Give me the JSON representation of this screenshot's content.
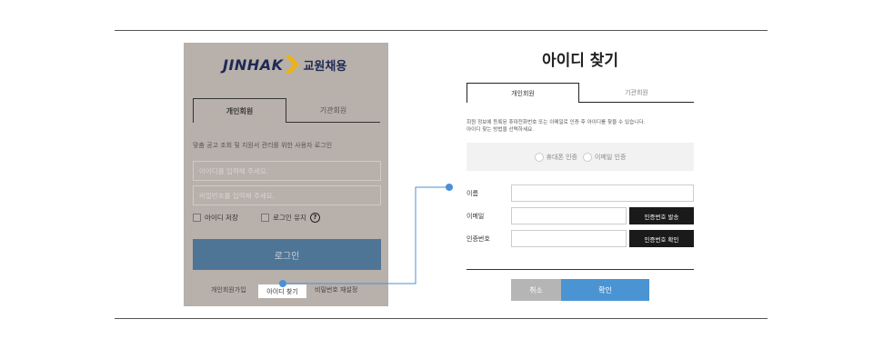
{
  "login": {
    "logo_main": "JINHAK",
    "logo_sub": "교원채용",
    "tabs": [
      {
        "label": "개인회원",
        "active": true
      },
      {
        "label": "기관회원",
        "active": false
      }
    ],
    "description": "맞춤 공고 조회 및 지원서 관리를 위한 사용자 로그인",
    "id_placeholder": "아이디를 입력해 주세요.",
    "pw_placeholder": "비밀번호를 입력해 주세요.",
    "save_id_label": "아이디 저장",
    "keep_login_label": "로그인 유지",
    "help_glyph": "?",
    "login_button": "로그인",
    "footer": {
      "join": "개인회원가입",
      "find_id": "아이디 찾기",
      "reset_pw": "비밀번호 재설정"
    }
  },
  "find_id": {
    "title": "아이디 찾기",
    "tabs": [
      {
        "label": "개인회원",
        "active": true
      },
      {
        "label": "기관회원",
        "active": false
      }
    ],
    "description_line1": "회원 정보에 등록된 휴대전화번호 또는 이메일로 인증 후 아이디를 찾을 수 있습니다.",
    "description_line2": "아이디 찾는 방법을 선택하세요.",
    "methods": [
      {
        "label": "휴대폰 인증"
      },
      {
        "label": "이메일 인증"
      }
    ],
    "fields": {
      "name_label": "이름",
      "email_label": "이메일",
      "code_label": "인증번호"
    },
    "send_code_button": "인증번호 발송",
    "verify_code_button": "인증번호 확인",
    "cancel_button": "취소",
    "confirm_button": "확인"
  },
  "colors": {
    "card_overlay": "#b8b0ab",
    "login_button": "#4f7596",
    "confirm_button": "#4a94d4",
    "connector": "#4a90d9",
    "logo_navy": "#1d2a55",
    "logo_gold": "#e8b31c"
  },
  "icons": [
    "logo-chevron-icon",
    "help-icon",
    "connector-dot-icon",
    "radio-icon"
  ]
}
